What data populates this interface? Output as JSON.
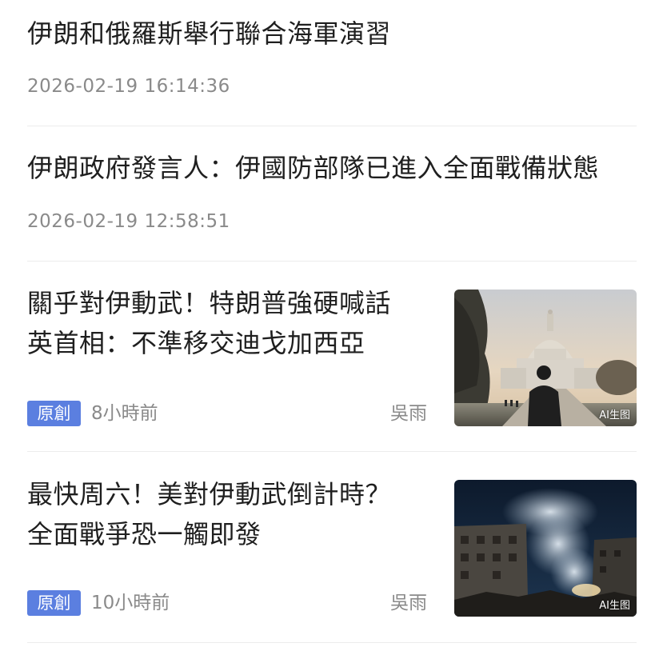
{
  "feed": {
    "items": [
      {
        "title": "伊朗和俄羅斯舉行聯合海軍演習",
        "time": "2026-02-19  16:14:36"
      },
      {
        "title": "伊朗政府發言人：伊國防部隊已進入全面戰備狀態",
        "time": "2026-02-19  12:58:51"
      },
      {
        "title_lines": [
          "關乎對伊動武！特朗普強硬喊話",
          "英首相：不準移交迪戈加西亞"
        ],
        "badge": "原創",
        "ago": "8小時前",
        "author": "吳雨",
        "thumb_tag": "AI生图",
        "thumb_icon": "capitol-building-image"
      },
      {
        "title_lines": [
          "最快周六！美對伊動武倒計時？",
          "全面戰爭恐一觸即發"
        ],
        "badge": "原創",
        "ago": "10小時前",
        "author": "吳雨",
        "thumb_tag": "AI生图",
        "thumb_icon": "ruined-city-image"
      }
    ]
  },
  "colors": {
    "badge_bg": "#5b7fe0",
    "meta_text": "#8a8a8a",
    "title_text": "#1f1f1f",
    "divider": "#ececec"
  }
}
